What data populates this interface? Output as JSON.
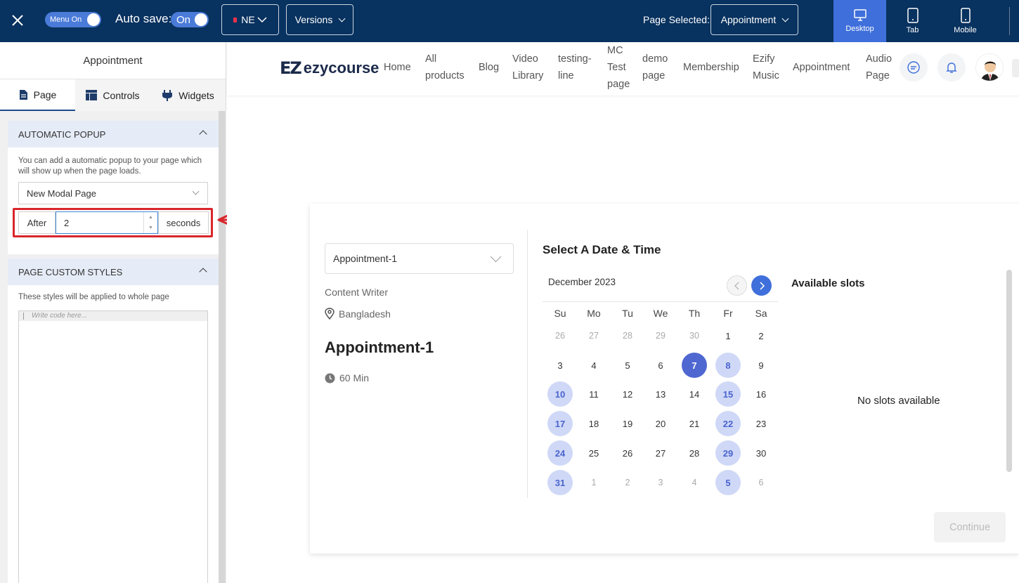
{
  "topbar": {
    "menu_toggle_label": "Menu On",
    "autosave_label": "Auto save:",
    "autosave_toggle_label": "On",
    "language_label": "NE",
    "versions_label": "Versions",
    "page_selected_label": "Page Selected:",
    "page_selected_value": "Appointment",
    "devices": [
      {
        "label": "Desktop",
        "icon": "desktop-icon",
        "active": true
      },
      {
        "label": "Tab",
        "icon": "tablet-icon",
        "active": false
      },
      {
        "label": "Mobile",
        "icon": "mobile-icon",
        "active": false
      }
    ],
    "accent_color": "#3f6fdb",
    "bar_color": "#08325f"
  },
  "sidebar": {
    "title": "Appointment",
    "tabs": [
      {
        "label": "Page",
        "icon": "page-icon",
        "active": true
      },
      {
        "label": "Controls",
        "icon": "layout-icon",
        "active": false
      },
      {
        "label": "Widgets",
        "icon": "plug-icon",
        "active": false
      }
    ],
    "popup_section": {
      "heading": "AUTOMATIC POPUP",
      "description": "You can add a automatic popup to your page which will show up when the page loads.",
      "modal_select_value": "New Modal Page",
      "after_label": "After",
      "delay_value": "2",
      "seconds_label": "seconds"
    },
    "styles_section": {
      "heading": "PAGE CUSTOM STYLES",
      "description": "These styles will be applied to whole page",
      "code_placeholder": "Write code here..."
    }
  },
  "site": {
    "logo_mark": "EZ",
    "logo_text": "ezycourse",
    "nav": [
      {
        "line1": "Home",
        "line2": "",
        "line3": ""
      },
      {
        "line1": "All",
        "line2": "products",
        "line3": ""
      },
      {
        "line1": "Blog",
        "line2": "",
        "line3": ""
      },
      {
        "line1": "Video",
        "line2": "Library",
        "line3": ""
      },
      {
        "line1": "testing-",
        "line2": "line",
        "line3": ""
      },
      {
        "line1": "MC",
        "line2": "Test",
        "line3": "page"
      },
      {
        "line1": "demo",
        "line2": "page",
        "line3": ""
      },
      {
        "line1": "Membership",
        "line2": "",
        "line3": ""
      },
      {
        "line1": "Ezify",
        "line2": "Music",
        "line3": ""
      },
      {
        "line1": "Appointment",
        "line2": "",
        "line3": ""
      },
      {
        "line1": "Audio",
        "line2": "Page",
        "line3": ""
      }
    ],
    "header_icons": [
      "chat-icon",
      "bell-icon",
      "avatar"
    ]
  },
  "booking": {
    "appointment_select_value": "Appointment-1",
    "host_role": "Content Writer",
    "location": "Bangladesh",
    "appointment_title": "Appointment-1",
    "duration": "60 Min",
    "picker_title": "Select A Date & Time",
    "month_label": "December 2023",
    "weekdays": [
      "Su",
      "Mo",
      "Tu",
      "We",
      "Th",
      "Fr",
      "Sa"
    ],
    "weeks": [
      [
        {
          "d": "26",
          "s": "muted"
        },
        {
          "d": "27",
          "s": "muted"
        },
        {
          "d": "28",
          "s": "muted"
        },
        {
          "d": "29",
          "s": "muted"
        },
        {
          "d": "30",
          "s": "muted"
        },
        {
          "d": "1",
          "s": ""
        },
        {
          "d": "2",
          "s": ""
        }
      ],
      [
        {
          "d": "3",
          "s": ""
        },
        {
          "d": "4",
          "s": ""
        },
        {
          "d": "5",
          "s": ""
        },
        {
          "d": "6",
          "s": ""
        },
        {
          "d": "7",
          "s": "selected"
        },
        {
          "d": "8",
          "s": "avail"
        },
        {
          "d": "9",
          "s": ""
        }
      ],
      [
        {
          "d": "10",
          "s": "avail"
        },
        {
          "d": "11",
          "s": ""
        },
        {
          "d": "12",
          "s": ""
        },
        {
          "d": "13",
          "s": ""
        },
        {
          "d": "14",
          "s": ""
        },
        {
          "d": "15",
          "s": "avail"
        },
        {
          "d": "16",
          "s": ""
        }
      ],
      [
        {
          "d": "17",
          "s": "avail"
        },
        {
          "d": "18",
          "s": ""
        },
        {
          "d": "19",
          "s": ""
        },
        {
          "d": "20",
          "s": ""
        },
        {
          "d": "21",
          "s": ""
        },
        {
          "d": "22",
          "s": "avail"
        },
        {
          "d": "23",
          "s": ""
        }
      ],
      [
        {
          "d": "24",
          "s": "avail"
        },
        {
          "d": "25",
          "s": ""
        },
        {
          "d": "26",
          "s": ""
        },
        {
          "d": "27",
          "s": ""
        },
        {
          "d": "28",
          "s": ""
        },
        {
          "d": "29",
          "s": "avail"
        },
        {
          "d": "30",
          "s": ""
        }
      ],
      [
        {
          "d": "31",
          "s": "avail"
        },
        {
          "d": "1",
          "s": "muted"
        },
        {
          "d": "2",
          "s": "muted"
        },
        {
          "d": "3",
          "s": "muted"
        },
        {
          "d": "4",
          "s": "muted"
        },
        {
          "d": "5",
          "s": "avail"
        },
        {
          "d": "6",
          "s": "muted"
        }
      ]
    ],
    "slots_title": "Available slots",
    "no_slots_text": "No slots available",
    "continue_label": "Continue",
    "selected_color": "#4f67d1",
    "available_color": "#cfd8f6"
  },
  "annotation": {
    "highlight_color": "#d9262c"
  }
}
